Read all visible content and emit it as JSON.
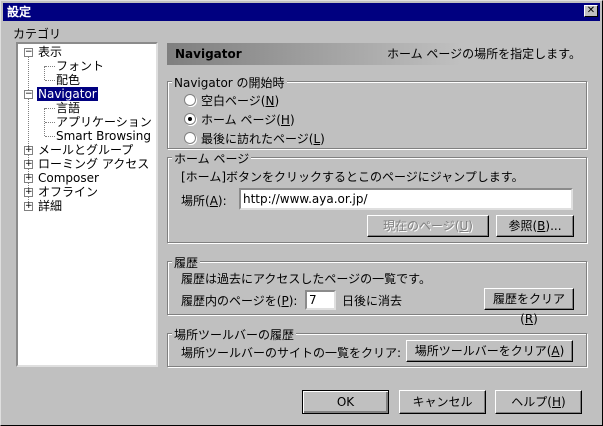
{
  "window": {
    "title": "設定",
    "close_glyph": "✕"
  },
  "category_label": "カテゴリ",
  "tree": {
    "display": "表示",
    "font": "フォント",
    "color": "配色",
    "navigator": "Navigator",
    "language": "言語",
    "application": "アプリケーション",
    "smart_browsing": "Smart Browsing",
    "mail_groups": "メールとグループ",
    "roaming": "ローミング アクセス",
    "composer": "Composer",
    "offline": "オフライン",
    "detail": "詳細"
  },
  "header": {
    "title": "Navigator",
    "description": "ホーム ページの場所を指定します。"
  },
  "startup": {
    "label": "Navigator の開始時",
    "blank": "空白ページ(",
    "blank_key": "N",
    "home": "ホーム ページ(",
    "home_key": "H",
    "last": "最後に訪れたページ(",
    "last_key": "L",
    "close_paren": ")",
    "selected": "home"
  },
  "homepage": {
    "label": "ホーム ページ",
    "hint": "[ホーム]ボタンをクリックするとこのページにジャンプします。",
    "location_label": "場所(",
    "location_key": "A",
    "location_tail": "):",
    "url": "http://www.aya.or.jp/",
    "current_page": "現在のページ(",
    "current_key": "U",
    "browse": "参照(",
    "browse_key": "B",
    "browse_tail": ")..."
  },
  "history": {
    "label": "履歴",
    "hint": "履歴は過去にアクセスしたページの一覧です。",
    "days_label": "履歴内のページを(",
    "days_key": "P",
    "days_tail": "):",
    "days_value": "7",
    "days_suffix": "日後に消去",
    "clear": "履歴をクリア(",
    "clear_key": "R"
  },
  "locbar": {
    "label": "場所ツールバーの履歴",
    "hint": "場所ツールバーのサイトの一覧をクリア:",
    "clear": "場所ツールバーをクリア(",
    "clear_key": "A"
  },
  "buttons": {
    "ok": "OK",
    "cancel": "キャンセル",
    "help": "ヘルプ(",
    "help_key": "H"
  }
}
